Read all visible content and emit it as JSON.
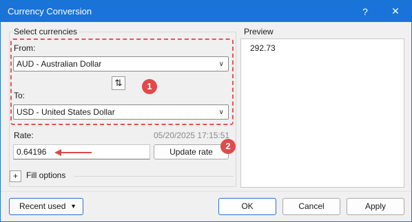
{
  "window": {
    "title": "Currency Conversion",
    "help_label": "?",
    "close_label": "✕"
  },
  "select_currencies": {
    "caption": "Select currencies",
    "from_label": "From:",
    "from_value": "AUD - Australian Dollar",
    "to_label": "To:",
    "to_value": "USD - United States Dollar",
    "swap_icon": "⇅"
  },
  "badges": [
    "1",
    "2"
  ],
  "rate": {
    "label": "Rate:",
    "timestamp": "05/20/2025 17:15:51",
    "value": "0.64196",
    "update_label": "Update rate"
  },
  "fill_options": {
    "toggle": "+",
    "label": "Fill options"
  },
  "preview": {
    "caption": "Preview",
    "value": "292.73"
  },
  "footer": {
    "recent_label": "Recent used",
    "recent_caret": "▼",
    "ok_label": "OK",
    "cancel_label": "Cancel",
    "apply_label": "Apply"
  },
  "colors": {
    "titlebar": "#1a73d9",
    "highlight": "#e04a4a"
  }
}
